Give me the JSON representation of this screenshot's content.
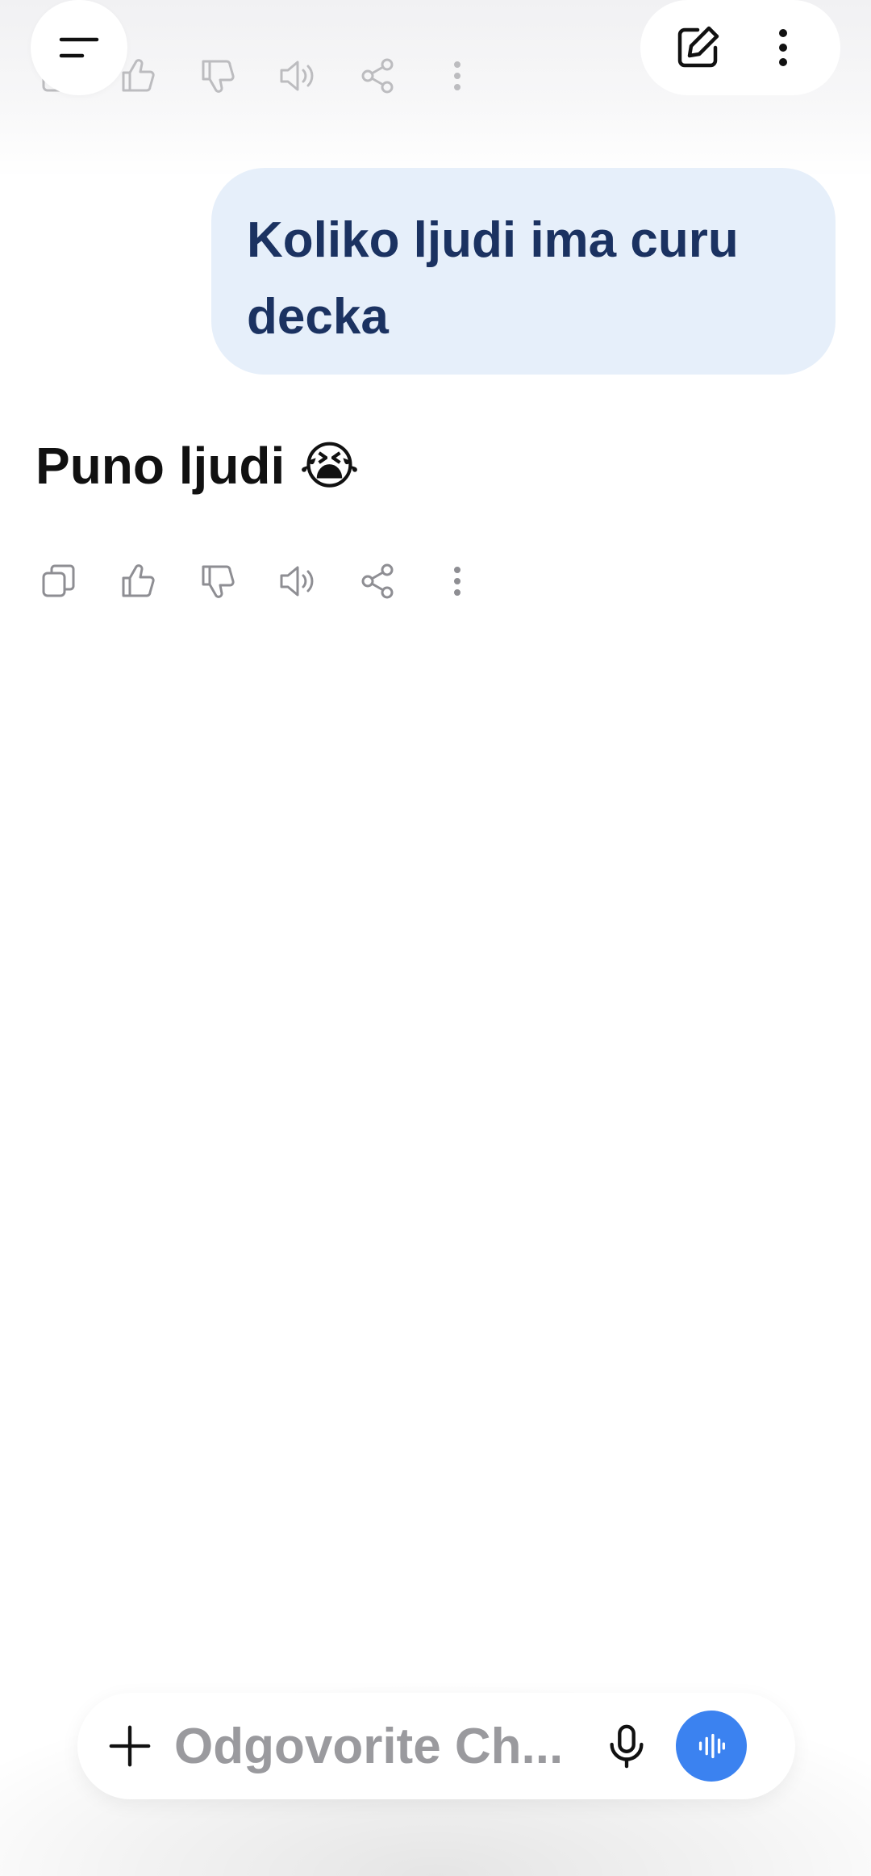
{
  "conversation": {
    "user_message": "Koliko ljudi ima curu decka",
    "assistant_reply": "Puno ljudi 😭"
  },
  "header": {
    "menu_icon": "menu-icon",
    "new_chat_icon": "edit-icon",
    "more_icon": "more-vertical-icon"
  },
  "message_actions": [
    "copy-icon",
    "thumbs-up-icon",
    "thumbs-down-icon",
    "speaker-icon",
    "share-icon",
    "more-vertical-icon"
  ],
  "composer": {
    "placeholder": "Odgovorite Ch...",
    "add_icon": "plus-icon",
    "mic_icon": "mic-icon",
    "voice_icon": "voice-mode-icon"
  },
  "colors": {
    "user_bubble_bg": "#e6effa",
    "user_bubble_text": "#1b3261",
    "voice_button": "#3b82f0",
    "icon_gray": "#8e8e93"
  }
}
